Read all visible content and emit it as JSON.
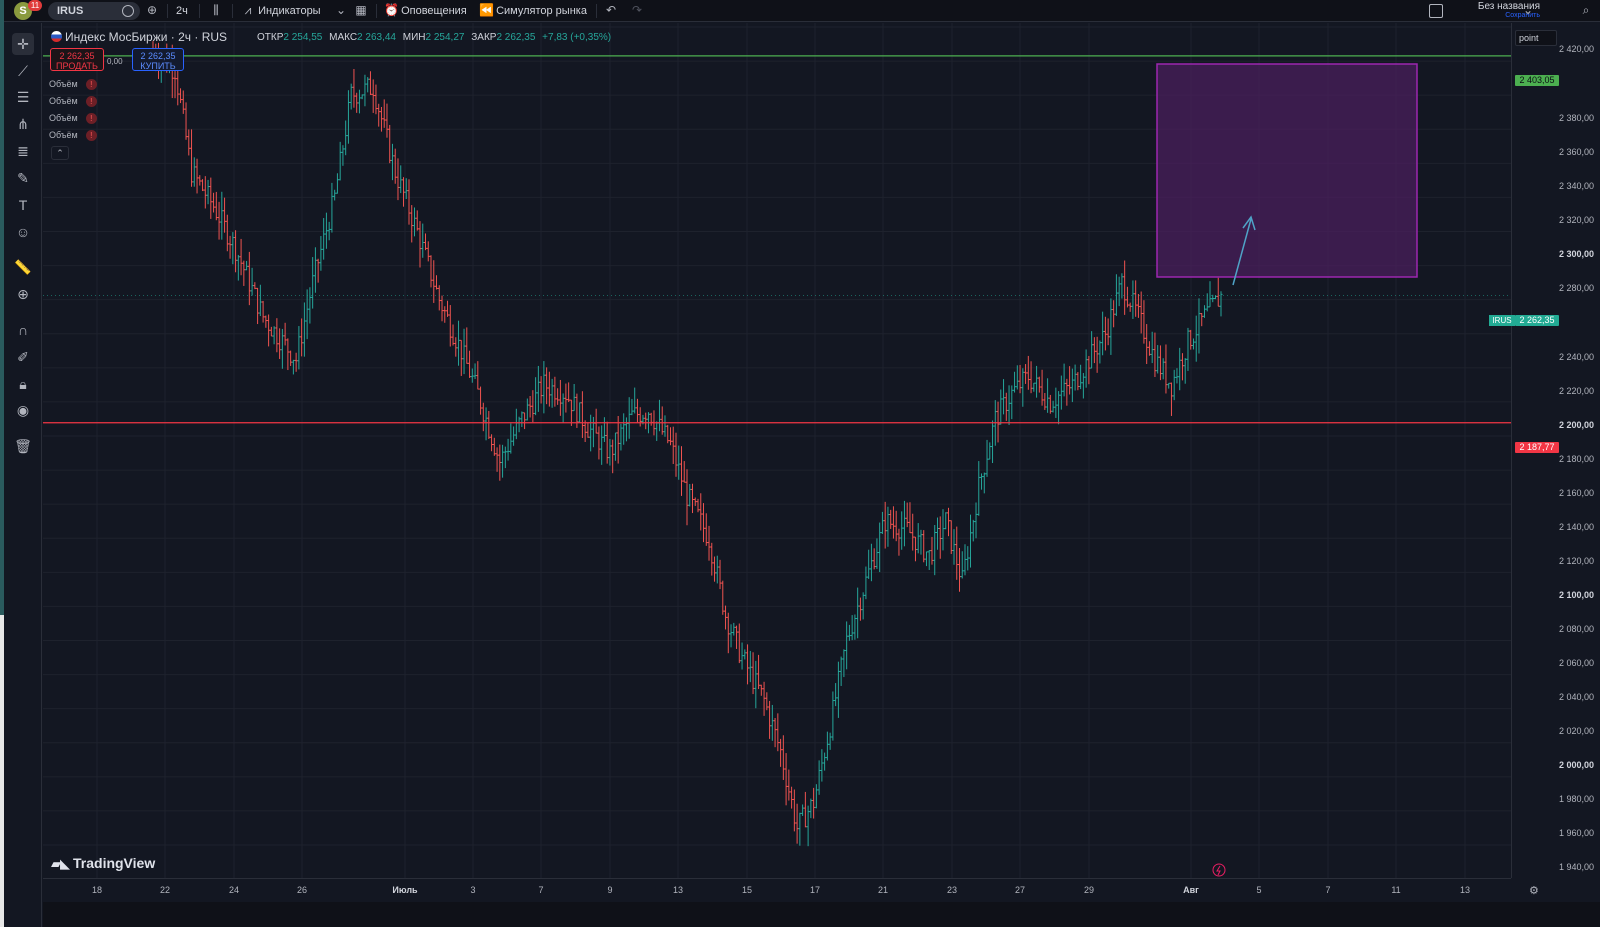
{
  "topbar": {
    "avatar_letter": "S",
    "notif_count": "11",
    "symbol": "IRUS",
    "interval": "2ч",
    "indicators_label": "Индикаторы",
    "alerts_label": "Оповещения",
    "replay_label": "Симулятор рынка",
    "layout_name": "Без названия",
    "save_status": "Сохранить"
  },
  "legend": {
    "title": "Индекс МосБиржи · 2ч · RUS",
    "open_label": "ОТКР",
    "open": "2 254,55",
    "high_label": "МАКС",
    "high": "2 263,44",
    "low_label": "МИН",
    "low": "2 254,27",
    "close_label": "ЗАКР",
    "close": "2 262,35",
    "change": "+7,83 (+0,35%)",
    "sell_price": "2 262,35",
    "sell_label": "ПРОДАТЬ",
    "spread": "0,00",
    "buy_price": "2 262,35",
    "buy_label": "КУПИТЬ",
    "volume_labels": [
      "Объём",
      "Объём",
      "Объём",
      "Объём"
    ],
    "collapse_glyph": "⌃"
  },
  "watermark": "TradingView",
  "price_axis": {
    "mode_label": "point",
    "ticks": [
      "2 420,00",
      "2 380,00",
      "2 360,00",
      "2 340,00",
      "2 320,00",
      "2 300,00",
      "2 280,00",
      "2 240,00",
      "2 220,00",
      "2 200,00",
      "2 180,00",
      "2 160,00",
      "2 140,00",
      "2 120,00",
      "2 100,00",
      "2 080,00",
      "2 060,00",
      "2 040,00",
      "2 020,00",
      "2 000,00",
      "1 980,00",
      "1 960,00",
      "1 940,00"
    ],
    "green_level": "2 403,05",
    "current_price": "2 262,35",
    "current_symbol": "IRUS",
    "red_level": "2 187,77"
  },
  "time_axis": {
    "ticks": [
      "18",
      "22",
      "24",
      "26",
      "Июль",
      "3",
      "7",
      "9",
      "13",
      "15",
      "17",
      "21",
      "23",
      "27",
      "29",
      "Авг",
      "5",
      "7",
      "11",
      "13"
    ]
  },
  "colors": {
    "up": "#26a69a",
    "down": "#ef5350",
    "green_line": "#4caf50",
    "red_line": "#f23645",
    "rect_fill": "#4a1f5c",
    "rect_border": "#9c27b0",
    "arrow": "#4fa3c7",
    "background": "#131722"
  },
  "chart_data": {
    "type": "bar",
    "title": "Индекс МосБиржи · 2ч · RUS",
    "xlabel": "",
    "ylabel": "",
    "ylim": [
      1930,
      2430
    ],
    "ohlc_last": {
      "open": 2254.55,
      "high": 2263.44,
      "low": 2254.27,
      "close": 2262.35
    },
    "horizontal_levels": [
      2403.05,
      2187.77
    ],
    "current_price": 2262.35,
    "grid": true
  }
}
